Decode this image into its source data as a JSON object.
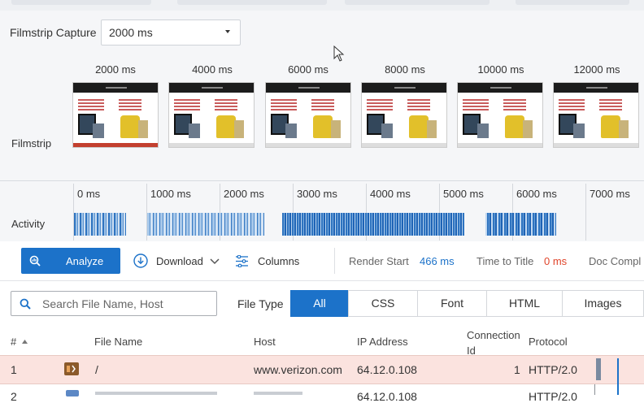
{
  "filmstrip": {
    "capture_label": "Filmstrip Capture",
    "capture_value": "2000 ms",
    "row_label": "Filmstrip",
    "frames": [
      "2000 ms",
      "4000 ms",
      "6000 ms",
      "8000 ms",
      "10000 ms",
      "12000 ms"
    ]
  },
  "activity": {
    "row_label": "Activity",
    "ticks": [
      "0 ms",
      "1000 ms",
      "2000 ms",
      "3000 ms",
      "4000 ms",
      "5000 ms",
      "6000 ms",
      "7000 ms"
    ]
  },
  "toolbar": {
    "analyze_label": "Analyze",
    "download_label": "Download",
    "columns_label": "Columns",
    "render_start_label": "Render Start",
    "render_start_value": "466 ms",
    "time_to_title_label": "Time to Title",
    "time_to_title_value": "0 ms",
    "doc_complete_label": "Doc Compl"
  },
  "filter": {
    "search_placeholder": "Search File Name, Host",
    "file_type_label": "File Type",
    "types": [
      "All",
      "CSS",
      "Font",
      "HTML",
      "Images"
    ],
    "active_type": "All"
  },
  "table": {
    "headers": {
      "num": "#",
      "file_name": "File Name",
      "host": "Host",
      "ip": "IP Address",
      "connection_line1": "Connection",
      "connection_line2": "Id",
      "protocol": "Protocol"
    },
    "rows": [
      {
        "num": "1",
        "file_name": "/",
        "host": "www.verizon.com",
        "ip": "64.12.0.108",
        "connection": "1",
        "protocol": "HTTP/2.0"
      },
      {
        "num": "2",
        "file_name": "",
        "host": "",
        "ip": "64.12.0.108",
        "connection": "",
        "protocol": "HTTP/2.0"
      }
    ]
  },
  "colors": {
    "accent": "#1c72c9",
    "render_start": "#1c72c9",
    "time_to_title": "#e0452b",
    "highlight_row": "#fbe3df"
  }
}
